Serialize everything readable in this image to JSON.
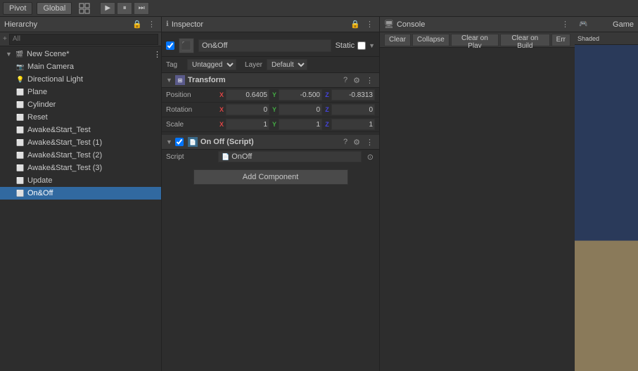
{
  "topbar": {
    "tabs": [
      "Pivot",
      "Global"
    ],
    "play_btn": "▶",
    "pause_btn": "⏸",
    "step_btn": "⏭"
  },
  "hierarchy": {
    "title": "Hierarchy",
    "search_placeholder": "All",
    "scene": "New Scene*",
    "items": [
      {
        "label": "Main Camera",
        "indent": 1,
        "icon": "camera"
      },
      {
        "label": "Directional Light",
        "indent": 1,
        "icon": "light"
      },
      {
        "label": "Plane",
        "indent": 1,
        "icon": "cube"
      },
      {
        "label": "Cylinder",
        "indent": 1,
        "icon": "cube"
      },
      {
        "label": "Reset",
        "indent": 1,
        "icon": "cube"
      },
      {
        "label": "Awake&Start_Test",
        "indent": 1,
        "icon": "cube"
      },
      {
        "label": "Awake&Start_Test (1)",
        "indent": 1,
        "icon": "cube"
      },
      {
        "label": "Awake&Start_Test (2)",
        "indent": 1,
        "icon": "cube"
      },
      {
        "label": "Awake&Start_Test (3)",
        "indent": 1,
        "icon": "cube"
      },
      {
        "label": "Update",
        "indent": 1,
        "icon": "cube"
      },
      {
        "label": "On&Off",
        "indent": 1,
        "icon": "cube",
        "selected": true
      }
    ]
  },
  "inspector": {
    "title": "Inspector",
    "obj_name": "On&Off",
    "static_label": "Static",
    "static_checked": false,
    "tag_label": "Tag",
    "tag_value": "Untagged",
    "layer_label": "Layer",
    "layer_value": "Default",
    "transform": {
      "title": "Transform",
      "position_label": "Position",
      "position_x": "0.6405",
      "position_y": "-0.500",
      "position_z": "-0.8313",
      "rotation_label": "Rotation",
      "rotation_x": "0",
      "rotation_y": "0",
      "rotation_z": "0",
      "scale_label": "Scale",
      "scale_x": "1",
      "scale_y": "1",
      "scale_z": "1"
    },
    "script_component": {
      "title": "On Off (Script)",
      "script_label": "Script",
      "script_value": "OnOff"
    },
    "add_component_label": "Add Component"
  },
  "console": {
    "title": "Console",
    "clear_label": "Clear",
    "collapse_label": "Collapse",
    "clear_on_play_label": "Clear on Play",
    "clear_on_build_label": "Clear on Build",
    "error_label": "Err"
  },
  "game": {
    "title": "Game",
    "shading_label": "Shaded"
  }
}
